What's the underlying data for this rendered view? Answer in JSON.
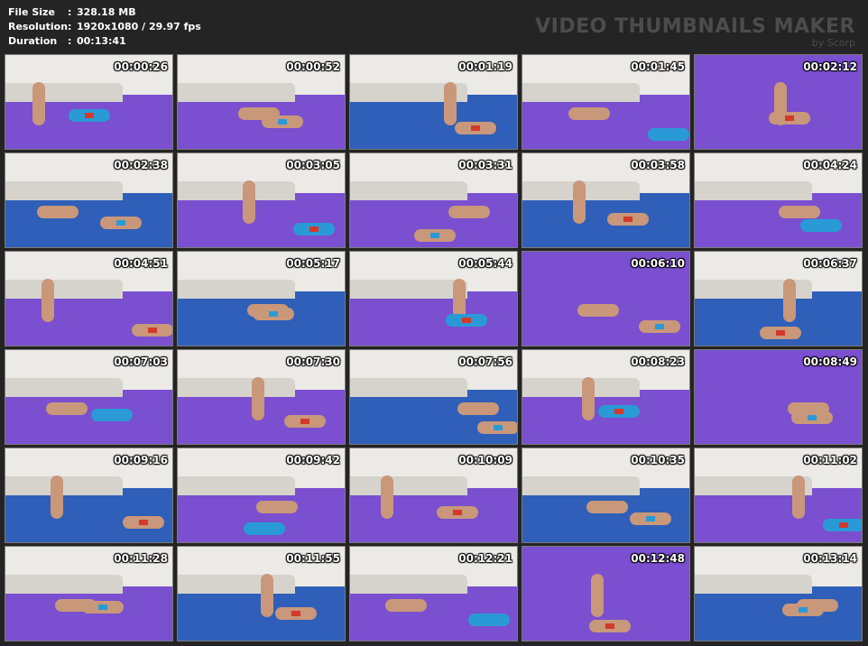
{
  "header": {
    "file_size_label": "File Size",
    "file_size_value": "328.18 MB",
    "resolution_label": "Resolution",
    "resolution_value": "1920x1080 / 29.97 fps",
    "duration_label": "Duration",
    "duration_value": "00:13:41",
    "separator": ":"
  },
  "brand": {
    "title": "VIDEO THUMBNAILS MAKER",
    "sub": "by Scorp"
  },
  "colors": {
    "background": "#242424",
    "mat_purple": "#7a4fd0",
    "mat_blue": "#2f5fb8",
    "wall_white": "#eceae6",
    "sofa": "#d6d3cc",
    "skin": "#c9977a",
    "shorts_blue": "#2a9ad6",
    "outfit_red": "#d23a2a"
  },
  "thumbnails": [
    {
      "time": "00:00:26"
    },
    {
      "time": "00:00:52"
    },
    {
      "time": "00:01:19"
    },
    {
      "time": "00:01:45"
    },
    {
      "time": "00:02:12"
    },
    {
      "time": "00:02:38"
    },
    {
      "time": "00:03:05"
    },
    {
      "time": "00:03:31"
    },
    {
      "time": "00:03:58"
    },
    {
      "time": "00:04:24"
    },
    {
      "time": "00:04:51"
    },
    {
      "time": "00:05:17"
    },
    {
      "time": "00:05:44"
    },
    {
      "time": "00:06:10"
    },
    {
      "time": "00:06:37"
    },
    {
      "time": "00:07:03"
    },
    {
      "time": "00:07:30"
    },
    {
      "time": "00:07:56"
    },
    {
      "time": "00:08:23"
    },
    {
      "time": "00:08:49"
    },
    {
      "time": "00:09:16"
    },
    {
      "time": "00:09:42"
    },
    {
      "time": "00:10:09"
    },
    {
      "time": "00:10:35"
    },
    {
      "time": "00:11:02"
    },
    {
      "time": "00:11:28"
    },
    {
      "time": "00:11:55"
    },
    {
      "time": "00:12:21"
    },
    {
      "time": "00:12:48"
    },
    {
      "time": "00:13:14"
    }
  ]
}
